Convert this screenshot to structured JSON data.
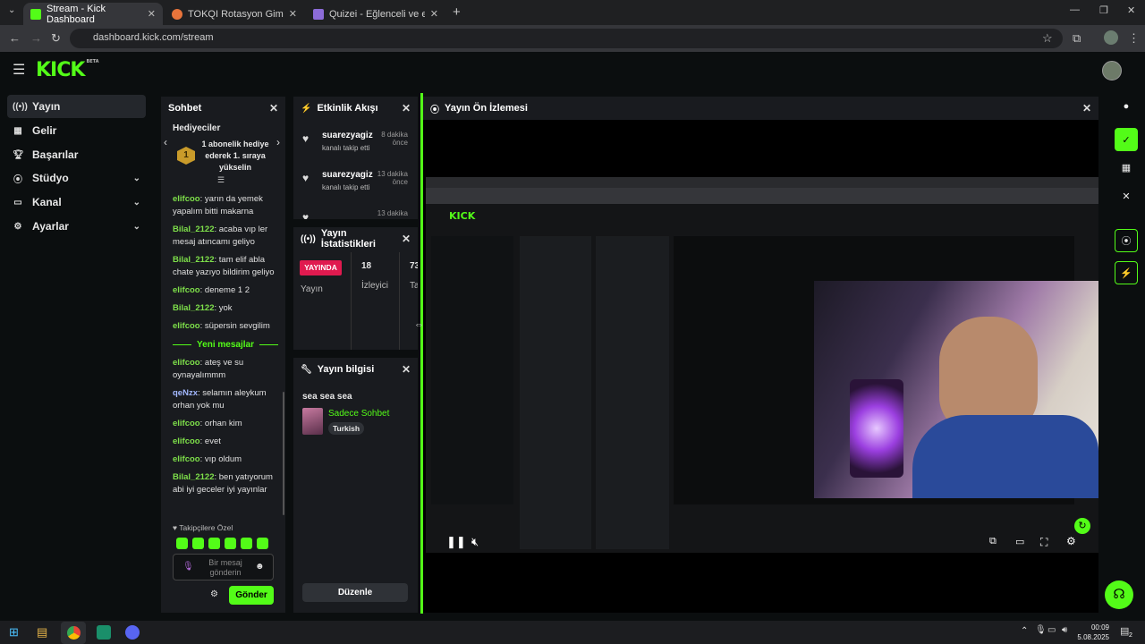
{
  "browser": {
    "tabs": [
      {
        "title": "Stream - Kick Dashboard",
        "active": true
      },
      {
        "title": "TOKQI Rotasyon Gimbal Sabitle",
        "active": false
      },
      {
        "title": "Quizei - Eğlenceli ve etkileşimli",
        "active": false
      }
    ],
    "url": "dashboard.kick.com/stream"
  },
  "logo": {
    "text": "KICK",
    "badge": "BETA"
  },
  "sidebar": {
    "items": [
      {
        "label": "Yayın",
        "icon": "broadcast-icon",
        "expandable": false
      },
      {
        "label": "Gelir",
        "icon": "revenue-icon",
        "expandable": false
      },
      {
        "label": "Başarılar",
        "icon": "trophy-icon",
        "expandable": false
      },
      {
        "label": "Stüdyo",
        "icon": "studio-icon",
        "expandable": true
      },
      {
        "label": "Kanal",
        "icon": "channel-icon",
        "expandable": true
      },
      {
        "label": "Ayarlar",
        "icon": "gear-icon",
        "expandable": true
      }
    ]
  },
  "chat": {
    "title": "Sohbet",
    "gifters_title": "Hediyeciler",
    "gift_text": "1 abonelik hediye ederek 1. sıraya yükselin",
    "gift_rank": "1",
    "messages_before": [
      {
        "user": "elifcoo",
        "text": "yarın da yemek yapalım bitti makarna"
      },
      {
        "user": "Bilal_2122",
        "text": "acaba vıp ler mesaj atıncamı geliyo"
      },
      {
        "user": "Bilal_2122",
        "text": "tam elif abla chate yazıyo bildirim geliyo"
      },
      {
        "user": "elifcoo",
        "text": "deneme 1 2"
      },
      {
        "user": "Bilal_2122",
        "text": "yok"
      },
      {
        "user": "elifcoo",
        "text": "süpersin sevgilim"
      }
    ],
    "new_messages_label": "Yeni mesajlar",
    "messages_after": [
      {
        "user": "elifcoo",
        "text": "ateş ve su oynayalımmm"
      },
      {
        "user": "qeNzx",
        "text": "selamın aleykum orhan yok mu"
      },
      {
        "user": "elifcoo",
        "text": "orhan kim"
      },
      {
        "user": "elifcoo",
        "text": "evet"
      },
      {
        "user": "elifcoo",
        "text": "vıp oldum"
      },
      {
        "user": "Bilal_2122",
        "text": "ben yatıyorum abi iyi geceler iyi yayınlar"
      }
    ],
    "followers_label": "Takipçilere Özel",
    "input_placeholder": "Bir mesaj gönderin",
    "send_label": "Gönder"
  },
  "activity": {
    "title": "Etkinlik Akışı",
    "items": [
      {
        "user": "suarezyagiz",
        "action": "kanalı takip etti",
        "time": "8 dakika önce"
      },
      {
        "user": "suarezyagiz",
        "action": "kanalı takip etti",
        "time": "13 dakika önce"
      },
      {
        "user": "",
        "action": "",
        "time": "13 dakika"
      }
    ]
  },
  "stats": {
    "title": "Yayın İstatistikleri",
    "live_badge": "YAYINDA",
    "col1_label": "Yayın",
    "viewers_value": "18",
    "viewers_label": "İzleyici",
    "third_value": "73",
    "third_label": "Ta"
  },
  "info": {
    "title": "Yayın bilgisi",
    "stream_title": "sea sea sea",
    "category": "Sadece Sohbet",
    "language": "Turkish",
    "edit_label": "Düzenle"
  },
  "preview": {
    "title": "Yayın Ön İzlemesi"
  },
  "taskbar": {
    "time": "00:09",
    "date": "5.08.2025",
    "notif": "2"
  },
  "colors": {
    "brand": "#53fc18",
    "panel": "#191b1f",
    "live": "#e01a4f"
  }
}
